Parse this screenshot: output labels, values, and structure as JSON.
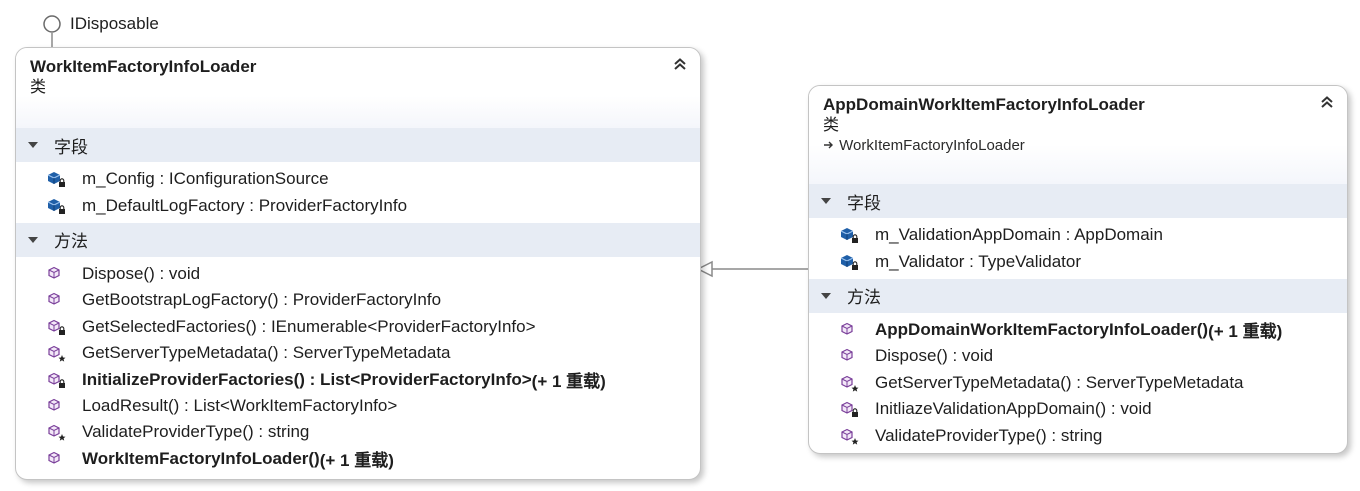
{
  "interface_lollipop": {
    "label": "IDisposable"
  },
  "left_class": {
    "name": "WorkItemFactoryInfoLoader",
    "kind": "类",
    "fields_title": "字段",
    "methods_title": "方法",
    "fields": [
      {
        "text": "m_Config : IConfigurationSource",
        "icon": "field-private-icon"
      },
      {
        "text": "m_DefaultLogFactory : ProviderFactoryInfo",
        "icon": "field-private-icon"
      }
    ],
    "methods": [
      {
        "text": "Dispose() : void",
        "icon": "method-public-icon"
      },
      {
        "text": "GetBootstrapLogFactory() : ProviderFactoryInfo",
        "icon": "method-public-icon"
      },
      {
        "text": "GetSelectedFactories() : IEnumerable<ProviderFactoryInfo>",
        "icon": "method-private-icon"
      },
      {
        "text": "GetServerTypeMetadata() : ServerTypeMetadata",
        "icon": "method-protected-icon"
      },
      {
        "text": "InitializeProviderFactories() : List<ProviderFactoryInfo>",
        "suffix": " (+ 1 重载)",
        "icon": "method-private-icon",
        "bold": true
      },
      {
        "text": "LoadResult() : List<WorkItemFactoryInfo>",
        "icon": "method-public-icon"
      },
      {
        "text": "ValidateProviderType() : string",
        "icon": "method-protected-icon"
      },
      {
        "text": "WorkItemFactoryInfoLoader()",
        "suffix": " (+ 1 重载)",
        "icon": "method-public-icon",
        "bold": true
      }
    ]
  },
  "right_class": {
    "name": "AppDomainWorkItemFactoryInfoLoader",
    "kind": "类",
    "base": "WorkItemFactoryInfoLoader",
    "fields_title": "字段",
    "methods_title": "方法",
    "fields": [
      {
        "text": "m_ValidationAppDomain : AppDomain",
        "icon": "field-private-icon"
      },
      {
        "text": "m_Validator : TypeValidator",
        "icon": "field-private-icon"
      }
    ],
    "methods": [
      {
        "text": "AppDomainWorkItemFactoryInfoLoader()",
        "suffix": " (+ 1 重载)",
        "icon": "method-public-icon",
        "bold": true
      },
      {
        "text": "Dispose() : void",
        "icon": "method-public-icon"
      },
      {
        "text": "GetServerTypeMetadata() : ServerTypeMetadata",
        "icon": "method-protected-icon"
      },
      {
        "text": "InitliazeValidationAppDomain() : void",
        "icon": "method-private-icon"
      },
      {
        "text": "ValidateProviderType() : string",
        "icon": "method-protected-icon"
      }
    ]
  },
  "colors": {
    "section_bg": "#e7ecf4",
    "field_icon": "#1f5fa8",
    "method_icon": "#7a3f9a",
    "border": "#c4c4c4",
    "connector": "#8a8a8a"
  }
}
